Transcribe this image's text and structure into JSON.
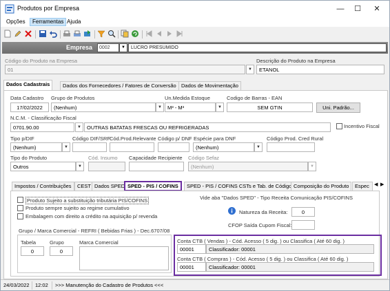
{
  "window": {
    "title": "Produtos por Empresa",
    "min_symbol": "—",
    "max_symbol": "☐",
    "close_symbol": "✕"
  },
  "menu": [
    "Opções",
    "Ferramentas",
    "Ajuda"
  ],
  "empresa": {
    "label": "Empresa",
    "code": "0002",
    "name": "LUCRO PRESUMIDO"
  },
  "codigo_produto": {
    "label": "Código do Produto na Empresa",
    "value": "01"
  },
  "descricao": {
    "label": "Descrição do Produto na Empresa",
    "value": "ETANOL"
  },
  "main_tabs": [
    "Dados Cadastrais",
    "Dados dos Fornecedores / Fatores de Conversão",
    "Dados de Movimentação"
  ],
  "cadastro": {
    "data_cadastro_label": "Data Cadastro",
    "data_cadastro": "17/02/2022",
    "grupo_label": "Grupo de Produtos",
    "grupo": "(Nenhum)",
    "un_medida_label": "Un.Medida Estoque",
    "un_medida": "M³ - M³",
    "cod_barras_label": "Codigo de Barras - EAN",
    "cod_barras": "SEM GTIN",
    "uni_padrao_button": "Uni. Padrão...",
    "ncm_label": "N.C.M. - Classificação Fiscal",
    "ncm": "0701.90.00",
    "ncm_desc": "OUTRAS BATATAS FRESCAS OU REFRIGERADAS",
    "incentivo_label": "Incentivo Fiscal",
    "tipo_dif_label": "Tipo p/DIF",
    "tipo_dif": "(Nenhum)",
    "codigo_dif_label": "Código DIF/SRF",
    "cod_prod_relevante_label": "Cód.Prod.Relevante",
    "codigo_dnf_label": "Código p/ DNF",
    "especie_dnf_label": "Espécie para DNF",
    "especie_dnf": "(Nenhum)",
    "cod_cred_rural_label": "Código Prod. Cred Rural",
    "tipo_produto_label": "Tipo do Produto",
    "tipo_produto": "Outros",
    "cod_insumo_label": "Cód. Insumo",
    "capacidade_label": "Capacidade Recipiente",
    "codigo_sefaz_label": "Código Sefaz",
    "codigo_sefaz": "(Nenhum)"
  },
  "sub_tabs": [
    "Impostos / Contribuições",
    "CEST",
    "Dados SPED",
    "SPED - PIS / COFINS",
    "SPED - PIS / COFINS CSTs e Tab. de Códigos",
    "Composição do Produto",
    "Espec"
  ],
  "sped": {
    "chk1": "Produto Sujeito a substituição tributária PIS/COFINS",
    "chk2": "Produto sempre sujeito ao regime cumulativo",
    "chk3": "Embalagem com direito a crédito na aquisição p/ revenda",
    "vide_aba": "Vide aba \"Dados SPED\" - Tipo Receita Comunicação PIS/COFINS",
    "natureza_label": "Natureza da Receita:",
    "natureza_value": "0",
    "cfop_label": "CFOP Saída Cupom Fiscal:",
    "grupo_title": "Grupo / Marca Comercial - REFRI ( Bebidas Frias ) - Dec.6707/08",
    "tabela_label": "Tabela",
    "tabela_value": "0",
    "grupo_label": "Grupo",
    "grupo_value": "0",
    "marca_label": "Marca Comercial",
    "ctb_vendas_label": "Conta CTB ( Vendas ) - Cód. Acesso ( 5 dig. ) ou Classifica ( Até 60 dig. )",
    "ctb_vendas_code": "00001",
    "ctb_vendas_class": "Classificador: 00001",
    "ctb_compras_label": "Conta CTB ( Compras ) - Cód. Acesso ( 5 dig. ) ou Classifica ( Até 60 dig. )",
    "ctb_compras_code": "00001",
    "ctb_compras_class": "Classificador: 00001"
  },
  "status": {
    "date": "24/03/2022",
    "time": "12:02",
    "message": ">>> Manutenção do Cadastro de Produtos <<<"
  },
  "colors": {
    "highlight": "#6a2da0",
    "header_bar": "#7d7d7d",
    "info_icon": "#2f6fd0"
  }
}
